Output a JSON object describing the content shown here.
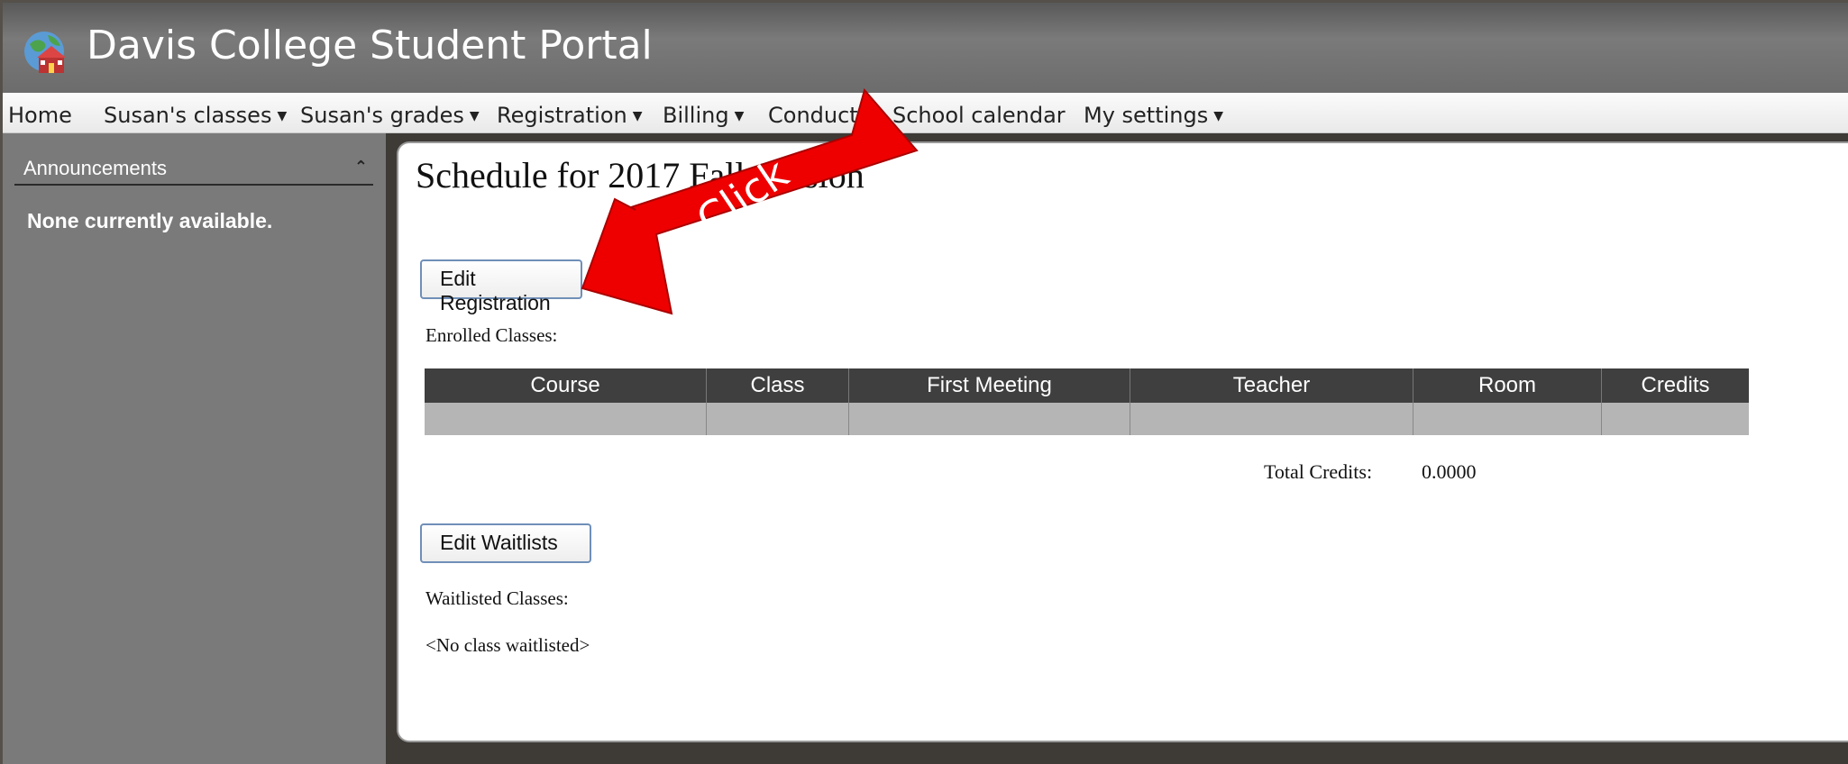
{
  "header": {
    "title": "Davis College Student Portal",
    "logo": "globe-schoolhouse-icon"
  },
  "nav": {
    "items": [
      {
        "label": "Home",
        "dropdown": false
      },
      {
        "label": "Susan's classes",
        "dropdown": true
      },
      {
        "label": "Susan's grades",
        "dropdown": true
      },
      {
        "label": "Registration",
        "dropdown": true
      },
      {
        "label": "Billing",
        "dropdown": true
      },
      {
        "label": "Conduct",
        "dropdown": true
      },
      {
        "label": "School calendar",
        "dropdown": false
      },
      {
        "label": "My settings",
        "dropdown": true
      }
    ]
  },
  "sidebar": {
    "heading": "Announcements",
    "toggle_icon": "collapse-up-icon",
    "body": "None currently available."
  },
  "main": {
    "title": "Schedule for 2017 Fall Session",
    "edit_registration_label": "Edit Registration",
    "enrolled_label": "Enrolled Classes:",
    "table": {
      "columns": [
        "Course",
        "Class",
        "First Meeting",
        "Teacher",
        "Room",
        "Credits"
      ],
      "rows": [
        [
          "",
          "",
          "",
          "",
          "",
          ""
        ]
      ]
    },
    "total_credits_label": "Total Credits:",
    "total_credits_value": "0.0000",
    "edit_waitlists_label": "Edit Waitlists",
    "waitlisted_label": "Waitlisted Classes:",
    "no_waitlist": "<No class waitlisted>"
  },
  "annotation": {
    "text": "Click",
    "color": "#ee0000"
  },
  "colors": {
    "nav_bg": "#f3f3f3",
    "sidebar_bg": "#7a7a7a",
    "table_header": "#3f3f3f",
    "button_border": "#6f8fb8"
  }
}
